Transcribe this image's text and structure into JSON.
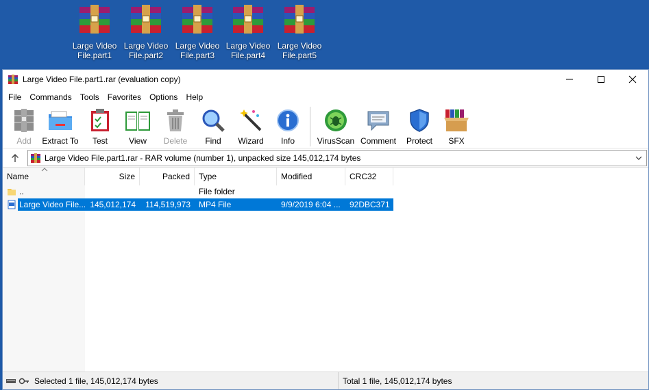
{
  "desktop": {
    "icons": [
      {
        "line1": "Large Video",
        "line2": "File.part1"
      },
      {
        "line1": "Large Video",
        "line2": "File.part2"
      },
      {
        "line1": "Large Video",
        "line2": "File.part3"
      },
      {
        "line1": "Large Video",
        "line2": "File.part4"
      },
      {
        "line1": "Large Video",
        "line2": "File.part5"
      }
    ]
  },
  "window": {
    "title": "Large Video File.part1.rar (evaluation copy)"
  },
  "menu": [
    "File",
    "Commands",
    "Tools",
    "Favorites",
    "Options",
    "Help"
  ],
  "toolbar": {
    "add": "Add",
    "extract_to": "Extract To",
    "test": "Test",
    "view": "View",
    "delete": "Delete",
    "find": "Find",
    "wizard": "Wizard",
    "info": "Info",
    "virusscan": "VirusScan",
    "comment": "Comment",
    "protect": "Protect",
    "sfx": "SFX"
  },
  "address": {
    "path": "Large Video File.part1.rar - RAR volume (number 1), unpacked size 145,012,174 bytes"
  },
  "columns": {
    "name": "Name",
    "size": "Size",
    "packed": "Packed",
    "type": "Type",
    "modified": "Modified",
    "crc": "CRC32"
  },
  "rows": [
    {
      "name": "..",
      "size": "",
      "packed": "",
      "type": "File folder",
      "modified": "",
      "crc": ""
    },
    {
      "name": "Large Video File....",
      "size": "145,012,174",
      "packed": "114,519,973",
      "type": "MP4 File",
      "modified": "9/9/2019 6:04 ...",
      "crc": "92DBC371"
    }
  ],
  "status": {
    "left": "Selected 1 file, 145,012,174 bytes",
    "right": "Total 1 file, 145,012,174 bytes"
  },
  "colors": {
    "desktop": "#1f5aa8",
    "selection": "#0078d7"
  }
}
